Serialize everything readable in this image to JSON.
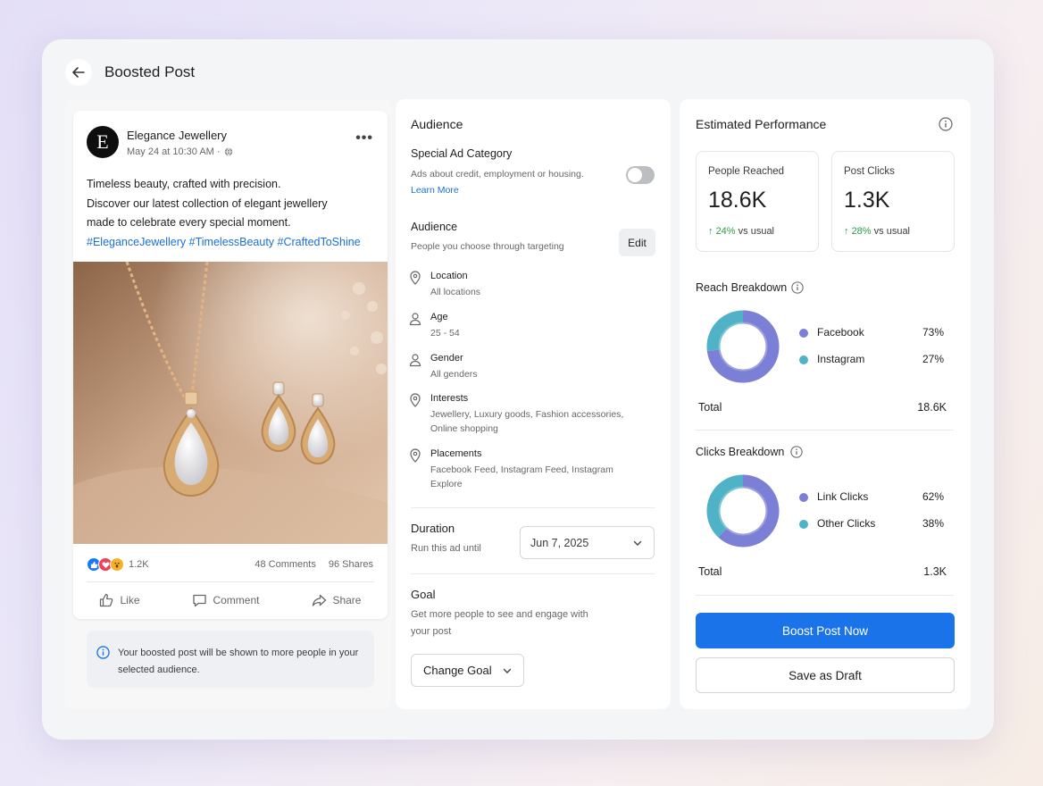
{
  "header": {
    "title": "Boosted Post"
  },
  "post": {
    "page_name": "Elegance Jewellery",
    "avatar_letter": "E",
    "timestamp": "May 24 at 10:30 AM · ",
    "text_lines": [
      "Timeless beauty, crafted with precision.",
      "Discover our latest collection of elegant jewellery",
      "made to celebrate every special moment."
    ],
    "hashtags": "#EleganceJewellery #TimelessBeauty #CraftedToShine",
    "reaction_count": "1.2K",
    "comments": "48 Comments",
    "shares": "96 Shares",
    "actions": {
      "like": "Like",
      "comment": "Comment",
      "share": "Share"
    }
  },
  "notice": {
    "text": "Your boosted post will be shown to more people in your selected audience."
  },
  "audience": {
    "title": "Audience",
    "special_ad": {
      "title": "Special Ad Category",
      "desc": "Ads about credit, employment or housing.",
      "link": "Learn More",
      "enabled": false
    },
    "audience_sub": {
      "title": "Audience",
      "desc": "People you choose through targeting",
      "edit_label": "Edit"
    },
    "targeting": [
      {
        "label": "Location",
        "value": "All locations",
        "icon": "location-pin-icon"
      },
      {
        "label": "Age",
        "value": "25 - 54",
        "icon": "person-icon"
      },
      {
        "label": "Gender",
        "value": "All genders",
        "icon": "person-icon"
      },
      {
        "label": "Interests",
        "value": "Jewellery, Luxury goods, Fashion accessories, Online shopping",
        "icon": "location-pin-icon"
      },
      {
        "label": "Placements",
        "value": "Facebook Feed, Instagram Feed, Instagram Explore",
        "icon": "location-pin-icon"
      }
    ],
    "duration": {
      "title": "Duration",
      "desc": "Run this ad until",
      "date": "Jun 7, 2025"
    },
    "goal": {
      "title": "Goal",
      "desc": "Get more people to see and engage with your post",
      "button": "Change Goal"
    }
  },
  "performance": {
    "title": "Estimated Performance",
    "stats": [
      {
        "label": "People Reached",
        "value": "18.6K",
        "change": "24%",
        "suffix": " vs usual"
      },
      {
        "label": "Post Clicks",
        "value": "1.3K",
        "change": "28%",
        "suffix": " vs usual"
      }
    ],
    "reach": {
      "title": "Reach Breakdown",
      "items": [
        {
          "name": "Facebook",
          "pct": "73%",
          "value": 73,
          "color": "#7b7fd6"
        },
        {
          "name": "Instagram",
          "pct": "27%",
          "value": 27,
          "color": "#4fb2c6"
        }
      ],
      "total_label": "Total",
      "total": "18.6K"
    },
    "clicks": {
      "title": "Clicks Breakdown",
      "items": [
        {
          "name": "Link Clicks",
          "pct": "62%",
          "value": 62,
          "color": "#7b7fd6"
        },
        {
          "name": "Other Clicks",
          "pct": "38%",
          "value": 38,
          "color": "#4fb2c6"
        }
      ],
      "total_label": "Total",
      "total": "1.3K"
    },
    "boost_button": "Boost Post Now",
    "draft_button": "Save as Draft"
  }
}
